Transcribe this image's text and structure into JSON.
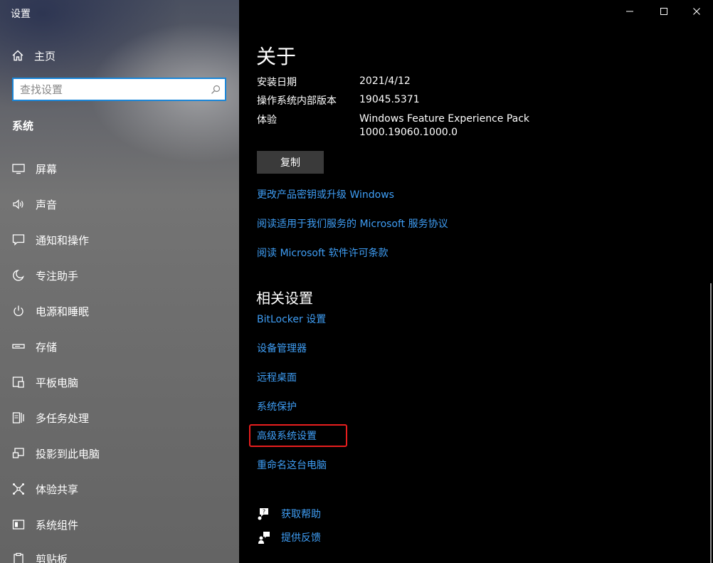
{
  "window": {
    "title": "设置"
  },
  "sidebar": {
    "home_label": "主页",
    "search_placeholder": "查找设置",
    "section_title": "系统",
    "items": [
      {
        "label": "屏幕",
        "icon": "display-icon"
      },
      {
        "label": "声音",
        "icon": "sound-icon"
      },
      {
        "label": "通知和操作",
        "icon": "notification-icon"
      },
      {
        "label": "专注助手",
        "icon": "focus-assist-icon"
      },
      {
        "label": "电源和睡眠",
        "icon": "power-icon"
      },
      {
        "label": "存储",
        "icon": "storage-icon"
      },
      {
        "label": "平板电脑",
        "icon": "tablet-icon"
      },
      {
        "label": "多任务处理",
        "icon": "multitasking-icon"
      },
      {
        "label": "投影到此电脑",
        "icon": "projecting-icon"
      },
      {
        "label": "体验共享",
        "icon": "shared-experiences-icon"
      },
      {
        "label": "系统组件",
        "icon": "system-components-icon"
      },
      {
        "label": "剪贴板",
        "icon": "clipboard-icon"
      }
    ]
  },
  "main": {
    "title": "关于",
    "props": [
      {
        "label": "安装日期",
        "value": "2021/4/12"
      },
      {
        "label": "操作系统内部版本",
        "value": "19045.5371"
      },
      {
        "label": "体验",
        "value": "Windows Feature Experience Pack",
        "value2": "1000.19060.1000.0"
      }
    ],
    "copy_button": "复制",
    "links": [
      "更改产品密钥或升级 Windows",
      "阅读适用于我们服务的 Microsoft 服务协议",
      "阅读 Microsoft 软件许可条款"
    ],
    "related_title": "相关设置",
    "related_links": [
      "BitLocker 设置",
      "设备管理器",
      "远程桌面",
      "系统保护",
      "高级系统设置",
      "重命名这台电脑"
    ],
    "help": [
      {
        "label": "获取帮助",
        "icon": "get-help-icon"
      },
      {
        "label": "提供反馈",
        "icon": "feedback-icon"
      }
    ]
  },
  "colors": {
    "link": "#3f9ef5",
    "highlight_box": "#e81e1e",
    "search_border": "#1a86d8"
  }
}
